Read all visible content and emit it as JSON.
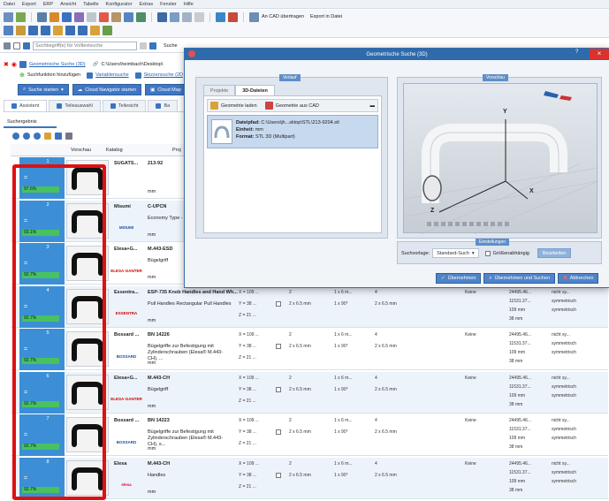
{
  "menu": [
    "Datei",
    "Export",
    "ERP",
    "Ansicht",
    "Tabelle",
    "Konfigurator",
    "Extras",
    "Fenster",
    "Hilfe"
  ],
  "toolbar": {
    "cad_dropdown": "An CAD übertragen",
    "export_dropdown": "Export in Datei"
  },
  "search": {
    "placeholder": "Suchbegriff(e) für Volltextsuche",
    "label": "Suche"
  },
  "breadcrumb": {
    "geo_link": "Geometrische Suche (3D)",
    "path": "C:\\Users\\heimbach\\Desktop\\",
    "add_label": "Suchfunktion hinzufügen",
    "variant_link": "Variablensuche",
    "sketch_link": "Skizzensuche (2D"
  },
  "actions": {
    "start_search": "Suche starten",
    "cloud_navigator": "Cloud Navigator starten",
    "cloud_map": "Cloud Map"
  },
  "nav_tabs": [
    "Assistent",
    "Teileauswahl",
    "Teilesicht",
    "Ba"
  ],
  "results": {
    "tab_label": "Suchergebnis",
    "col_preview": "Vorschau",
    "col_catalog": "Katalog",
    "col_proj": "Proj"
  },
  "rows": [
    {
      "rank": "1",
      "pct": "97.6%",
      "catalog": "SUGATS...",
      "proj_title": "213-92",
      "proj_desc": "",
      "unit": "mm",
      "logo": "",
      "logo_color": "#c33"
    },
    {
      "rank": "2",
      "pct": "93.1%",
      "catalog": "Misumi",
      "proj_title": "C-UPCN",
      "proj_desc": "Economy Type - Plast",
      "unit": "mm",
      "logo": "MISUMI",
      "logo_color": "#1a4ea0"
    },
    {
      "rank": "3",
      "pct": "92.7%",
      "catalog": "Elesa+G...",
      "proj_title": "M.443-ESD",
      "proj_desc": "Bügelgriff",
      "unit": "mm",
      "logo": "ELESA·GANTER",
      "logo_color": "#c00"
    },
    {
      "rank": "4",
      "pct": "92.7%",
      "catalog": "Essentra...",
      "proj_title": "ESP-735 Knob Handles and Hand Wh...",
      "proj_desc": "Pull Handles Rectangular Pull Handles",
      "unit": "mm",
      "logo": "ESSENTRA",
      "logo_color": "#c00"
    },
    {
      "rank": "5",
      "pct": "92.7%",
      "catalog": "Bossard ...",
      "proj_title": "BN 14226",
      "proj_desc": "Bügelgriffe zur Befestigung mit Zylinderschrauben (Elesa® M.443-CH), ...",
      "unit": "mm",
      "logo": "BOSSARD",
      "logo_color": "#1a4ea0"
    },
    {
      "rank": "6",
      "pct": "92.7%",
      "catalog": "Elesa+G...",
      "proj_title": "M.443-CH",
      "proj_desc": "Bügelgriff",
      "unit": "mm",
      "logo": "ELESA·GANTER",
      "logo_color": "#c00"
    },
    {
      "rank": "7",
      "pct": "92.7%",
      "catalog": "Bossard ...",
      "proj_title": "BN 14223",
      "proj_desc": "Bügelgriffe zur Befestigung mit Zylinderschrauben (Elesa® M.443-CH), s...",
      "unit": "mm",
      "logo": "BOSSARD",
      "logo_color": "#1a4ea0"
    },
    {
      "rank": "8",
      "pct": "92.7%",
      "catalog": "Elesa",
      "proj_title": "M.443-CH",
      "proj_desc": "Handles",
      "unit": "mm",
      "logo": "elesa",
      "logo_color": "#e03"
    }
  ],
  "row_cells": {
    "dim_x": "X = 109 ...",
    "dim_y": "Y = 38 ...",
    "dim_z": "Z = 21 ...",
    "holes": "2",
    "hole_size": "2 x 6.5 mm",
    "a": "1 x 6 m...",
    "b": "1 x 90°",
    "c": "4",
    "d": "2 x 6.5 mm",
    "keine": "Keine",
    "e": "24495.46...",
    "f": "11531.37...",
    "g": "109 mm",
    "h": "38 mm",
    "i": "nicht sy...",
    "j": "symmetrisch",
    "k": "symmetrisch"
  },
  "dialog": {
    "title": "Geometrische Suche (3D)",
    "close": "×",
    "help": "?",
    "group_verlauf": "Verlauf",
    "group_vorschau": "Vorschau",
    "group_einstellungen": "Einstellungen",
    "tab_projekte": "Projekte",
    "tab_3d": "3D-Dateien",
    "load_geo": "Geometrie laden",
    "geo_cad": "Geometrie aus CAD",
    "path_label": "Dateipfad:",
    "path_value": "C:\\Users\\jh...sktop\\STL\\213-9204.stl",
    "unit_label": "Einheit:",
    "unit_value": "mm",
    "format_label": "Format:",
    "format_value": "STL 3D (Multipart)",
    "template_label": "Suchvorlage:",
    "template_value": "Standard-Such",
    "size_dep": "Größenabhängig",
    "edit": "Bearbeiten",
    "apply": "Übernehmen",
    "apply_search": "Übernehmen und Suchen",
    "cancel": "Abbrechen",
    "axis_x": "X",
    "axis_y": "Y",
    "axis_z": "Z"
  }
}
